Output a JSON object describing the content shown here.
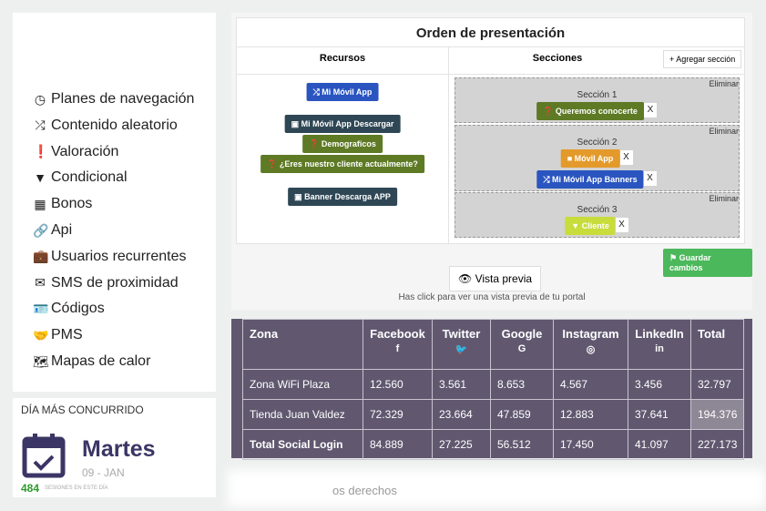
{
  "sidebar": {
    "items": [
      {
        "icon": "clock-icon",
        "glyph": "◷",
        "label": "Planes de navegación"
      },
      {
        "icon": "shuffle-icon",
        "glyph": "⤮",
        "label": "Contenido aleatorio"
      },
      {
        "icon": "exclamation-icon",
        "glyph": "❗",
        "label": "Valoración"
      },
      {
        "icon": "filter-icon",
        "glyph": "▼",
        "label": "Condicional"
      },
      {
        "icon": "qrcode-icon",
        "glyph": "▦",
        "label": "Bonos"
      },
      {
        "icon": "link-icon",
        "glyph": "🔗",
        "label": "Api"
      },
      {
        "icon": "briefcase-icon",
        "glyph": "💼",
        "label": "Usuarios recurrentes"
      },
      {
        "icon": "envelope-icon",
        "glyph": "✉",
        "label": "SMS de proximidad"
      },
      {
        "icon": "id-card-icon",
        "glyph": "🪪",
        "label": "Códigos"
      },
      {
        "icon": "handshake-icon",
        "glyph": "🤝",
        "label": "PMS"
      },
      {
        "icon": "map-icon",
        "glyph": "🗺",
        "label": "Mapas de calor"
      }
    ]
  },
  "busiest_day": {
    "title": "DÍA MÁS CONCURRIDO",
    "day": "Martes",
    "date": "09 - JAN",
    "sessions": "484",
    "sessions_label": "SESIONES EN ESTE DÍA"
  },
  "order": {
    "title": "Orden de presentación",
    "resources_header": "Recursos",
    "sections_header": "Secciones",
    "add_section": "+ Agregar sección",
    "resources": [
      {
        "label": "⤮ Mi Móvil App",
        "color": "#2a55c0"
      },
      {
        "label": "▣ Mi Móvil App Descargar",
        "color": "#2f4755"
      },
      {
        "label": "❓ Demograficos",
        "color": "#5e7a25"
      },
      {
        "label": "❓ ¿Eres nuestro cliente actualmente?",
        "color": "#5e7a25"
      },
      {
        "label": "▣ Banner Descarga APP",
        "color": "#2f4755"
      }
    ],
    "delete_label": "Eliminar",
    "remove_label": "X",
    "sections": [
      {
        "title": "Sección 1",
        "items": [
          {
            "label": "❓ Queremos conocerte",
            "color": "#5e7a25"
          }
        ]
      },
      {
        "title": "Sección 2",
        "items": [
          {
            "label": "■ Móvil App",
            "color": "#e39a2a"
          },
          {
            "label": "⤮ Mi Móvil App Banners",
            "color": "#2a55c0"
          }
        ]
      },
      {
        "title": "Sección 3",
        "items": [
          {
            "label": "▼ Cliente",
            "color": "#c8dc3c"
          }
        ]
      }
    ],
    "save": "⚑ Guardar cambios",
    "preview": "👁 Vista previa",
    "preview_hint": "Has click para ver una vista previa de tu portal"
  },
  "table": {
    "headers": [
      {
        "label": "Zona",
        "icon": ""
      },
      {
        "label": "Facebook",
        "icon": "f"
      },
      {
        "label": "Twitter",
        "icon": "🐦"
      },
      {
        "label": "Google",
        "icon": "G"
      },
      {
        "label": "Instagram",
        "icon": "◎"
      },
      {
        "label": "LinkedIn",
        "icon": "in"
      },
      {
        "label": "Total",
        "icon": ""
      }
    ],
    "rows": [
      [
        "Zona WiFi Plaza",
        "12.560",
        "3.561",
        "8.653",
        "4.567",
        "3.456",
        "32.797"
      ],
      [
        "Tienda Juan Valdez",
        "72.329",
        "23.664",
        "47.859",
        "12.883",
        "37.641",
        "194.376"
      ],
      [
        "Total Social Login",
        "84.889",
        "27.225",
        "56.512",
        "17.450",
        "41.097",
        "227.173"
      ]
    ]
  },
  "footer": {
    "text": "os derechos"
  }
}
